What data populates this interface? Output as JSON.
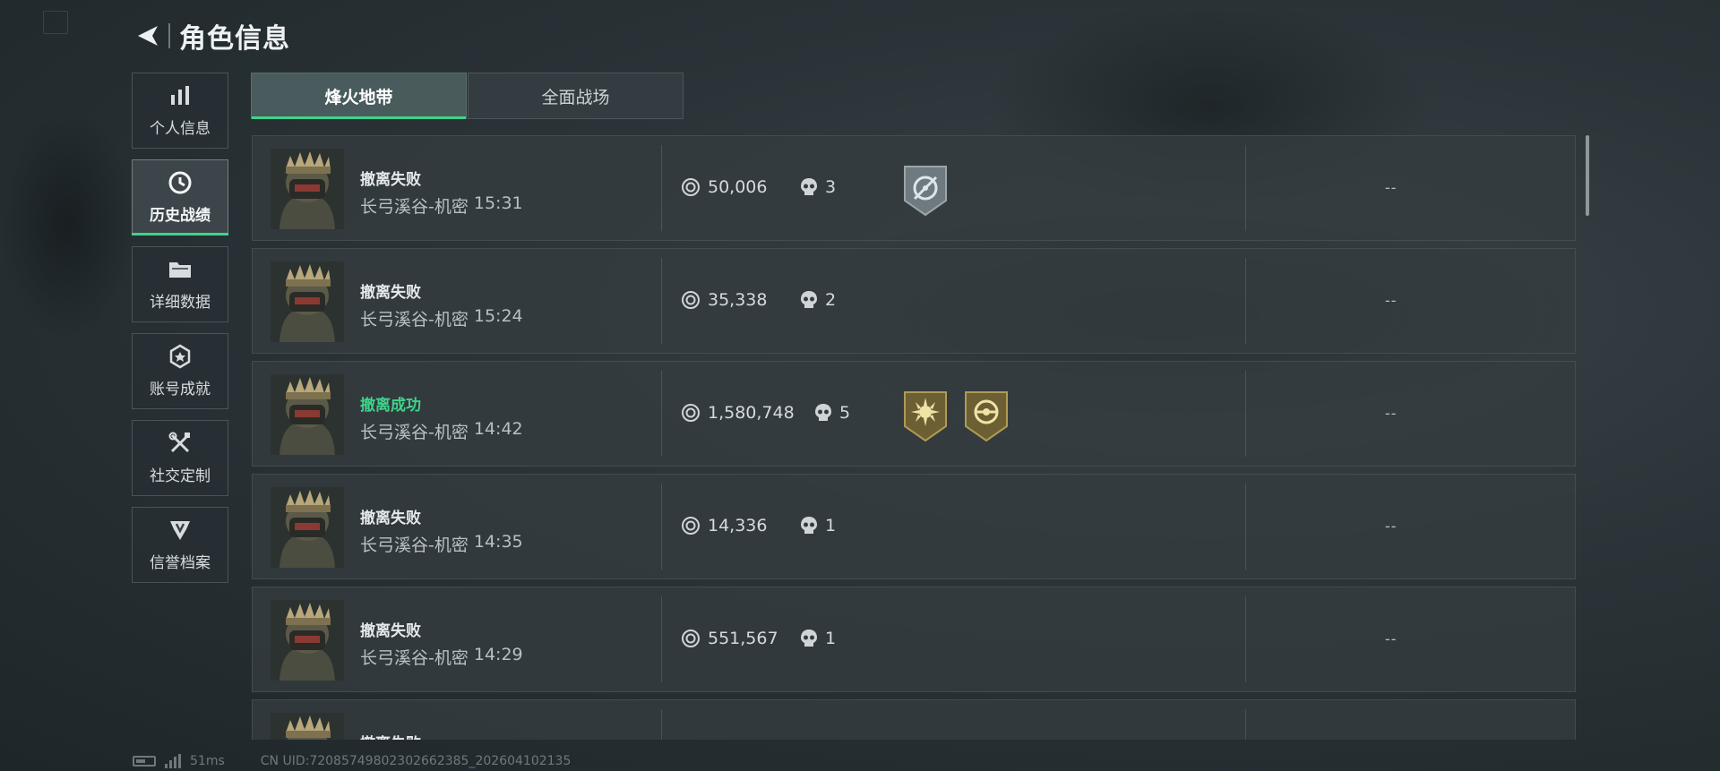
{
  "header": {
    "title": "角色信息"
  },
  "sidebar": {
    "items": [
      {
        "label": "个人信息",
        "icon": "bar-chart-icon",
        "active": false
      },
      {
        "label": "历史战绩",
        "icon": "clock-icon",
        "active": true
      },
      {
        "label": "详细数据",
        "icon": "folder-icon",
        "active": false
      },
      {
        "label": "账号成就",
        "icon": "achievement-icon",
        "active": false
      },
      {
        "label": "社交定制",
        "icon": "tools-icon",
        "active": false
      },
      {
        "label": "信誉档案",
        "icon": "reputation-icon",
        "active": false
      }
    ]
  },
  "tabs": [
    {
      "label": "烽火地带",
      "active": true
    },
    {
      "label": "全面战场",
      "active": false
    }
  ],
  "matches": [
    {
      "status": "撤离失败",
      "result": "fail",
      "map": "长弓溪谷-机密",
      "time": "15:31",
      "value": "50,006",
      "kills": "3",
      "badges": [
        "silver-target-badge"
      ],
      "extra": "--"
    },
    {
      "status": "撤离失败",
      "result": "fail",
      "map": "长弓溪谷-机密",
      "time": "15:24",
      "value": "35,338",
      "kills": "2",
      "badges": [],
      "extra": "--"
    },
    {
      "status": "撤离成功",
      "result": "success",
      "map": "长弓溪谷-机密",
      "time": "14:42",
      "value": "1,580,748",
      "kills": "5",
      "badges": [
        "gold-sun-badge",
        "gold-emblem-badge"
      ],
      "extra": "--"
    },
    {
      "status": "撤离失败",
      "result": "fail",
      "map": "长弓溪谷-机密",
      "time": "14:35",
      "value": "14,336",
      "kills": "1",
      "badges": [],
      "extra": "--"
    },
    {
      "status": "撤离失败",
      "result": "fail",
      "map": "长弓溪谷-机密",
      "time": "14:29",
      "value": "551,567",
      "kills": "1",
      "badges": [],
      "extra": "--"
    },
    {
      "status": "撤离失败",
      "result": "fail",
      "map": "",
      "time": "",
      "value": "",
      "kills": "",
      "badges": [],
      "extra": ""
    }
  ],
  "statusbar": {
    "ping": "51ms",
    "uid": "CN UID:720857498023026623​85_202604102135"
  },
  "colors": {
    "accent": "#3fd38b",
    "panel": "#343c40",
    "text": "#d9dde0"
  }
}
